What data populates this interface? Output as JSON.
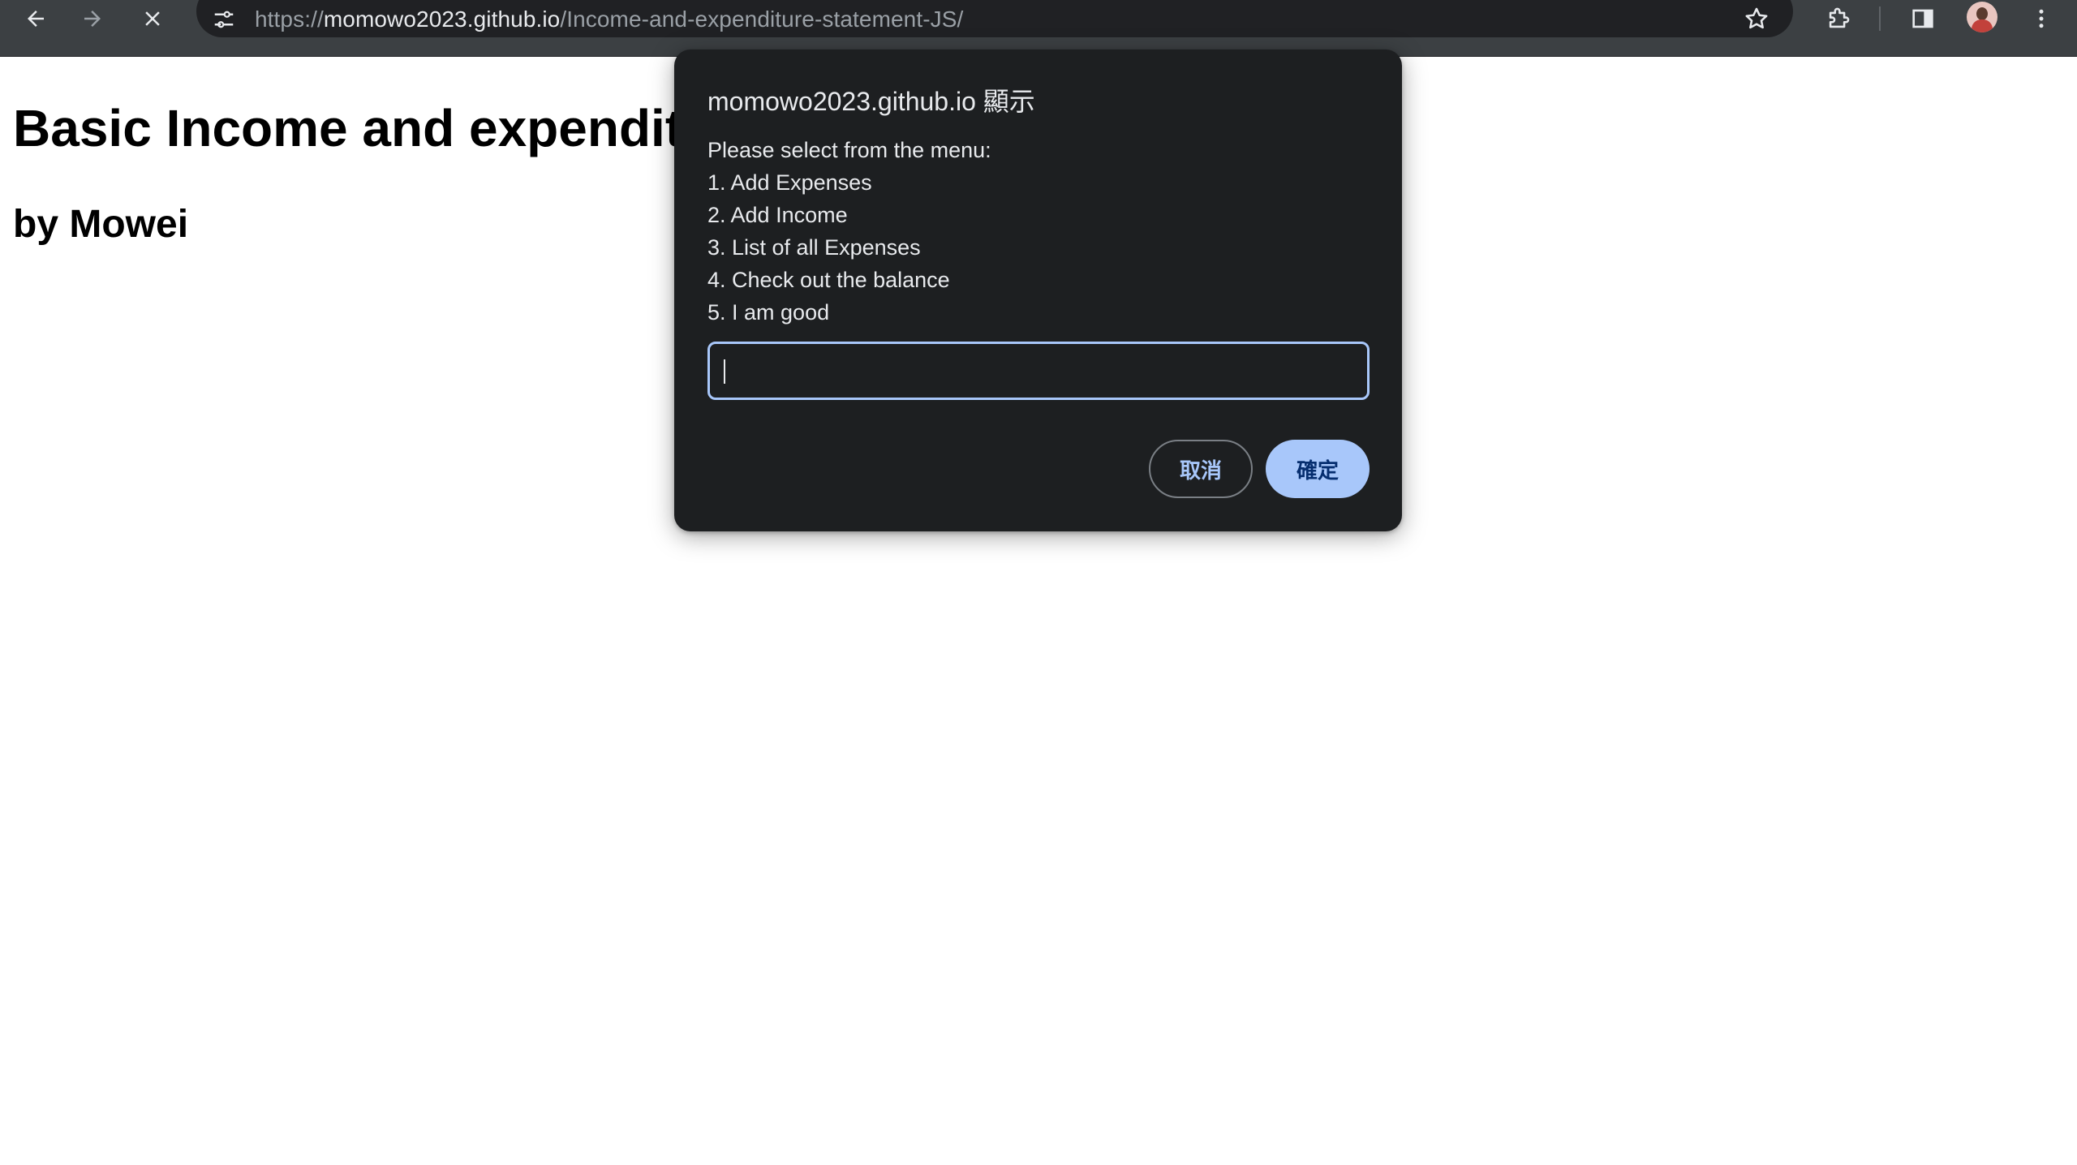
{
  "browser": {
    "url_scheme": "https://",
    "url_host": "momowo2023.github.io",
    "url_path": "/Income-and-expenditure-statement-JS/",
    "icons": {
      "back": "back-arrow-icon",
      "forward": "forward-arrow-icon",
      "stop": "close-icon",
      "site_info": "tune-icon",
      "bookmark": "star-icon",
      "extensions": "puzzle-icon",
      "side_panel": "side-panel-icon",
      "profile": "avatar",
      "menu": "more-vertical-icon"
    },
    "colors": {
      "toolbar": "#3c4043",
      "omnibox": "#202124"
    }
  },
  "page": {
    "title": "Basic Income and expenditure statement",
    "subtitle": "by Mowei"
  },
  "dialog": {
    "title": "momowo2023.github.io 顯示",
    "message_lines": [
      "Please select from the menu:",
      "1. Add Expenses",
      "2. Add Income",
      "3. List of all Expenses",
      "4. Check out the balance",
      "5. I am good"
    ],
    "input_value": "",
    "cancel_label": "取消",
    "ok_label": "確定",
    "colors": {
      "background": "#1d1f21",
      "accent": "#a8c7fa"
    }
  }
}
